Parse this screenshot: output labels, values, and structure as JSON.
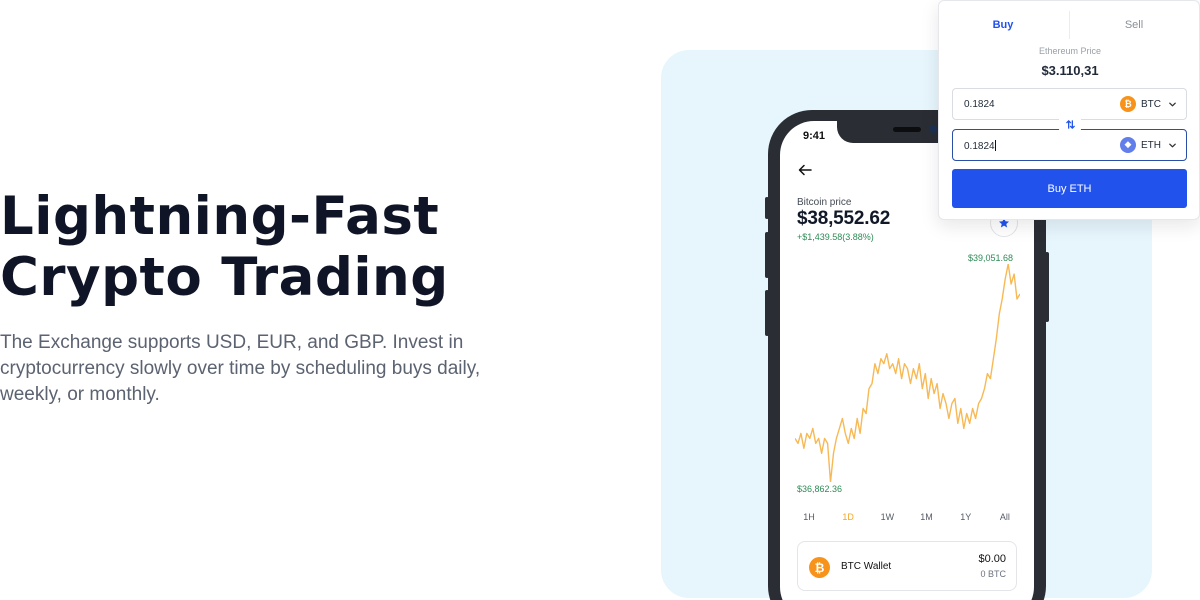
{
  "hero": {
    "title_line1": "Lightning-Fast",
    "title_line2": "Crypto Trading",
    "description": "The Exchange supports USD, EUR, and GBP. Invest in cryptocurrency slowly over time by scheduling buys daily, weekly, or monthly."
  },
  "phone": {
    "status_time": "9:41",
    "price_label": "Bitcoin price",
    "price_value": "$38,552.62",
    "price_change": "+$1,439.58(3.88%)",
    "chart_high": "$39,051.68",
    "chart_low": "$36,862.36",
    "timeframes": [
      {
        "label": "1H",
        "active": false
      },
      {
        "label": "1D",
        "active": true
      },
      {
        "label": "1W",
        "active": false
      },
      {
        "label": "1M",
        "active": false
      },
      {
        "label": "1Y",
        "active": false
      },
      {
        "label": "All",
        "active": false
      }
    ],
    "wallet": {
      "name": "BTC Wallet",
      "value": "$0.00",
      "amount": "0 BTC",
      "icon_glyph": "₿"
    },
    "chart_color": "#f7b955",
    "chart_series": [
      37300,
      37250,
      37350,
      37200,
      37350,
      37300,
      37400,
      37250,
      37300,
      37150,
      37300,
      37250,
      36862,
      37150,
      37300,
      37400,
      37500,
      37350,
      37250,
      37400,
      37300,
      37500,
      37350,
      37600,
      37550,
      37800,
      37850,
      38050,
      37950,
      38100,
      38050,
      38150,
      38000,
      38050,
      37950,
      38100,
      37900,
      38050,
      38000,
      37850,
      38000,
      37900,
      38050,
      37800,
      37950,
      37700,
      37900,
      37750,
      37850,
      37600,
      37750,
      37650,
      37500,
      37650,
      37700,
      37450,
      37600,
      37400,
      37550,
      37450,
      37600,
      37500,
      37650,
      37700,
      37800,
      37950,
      37900,
      38100,
      38300,
      38550,
      38700,
      38900,
      39051,
      38850,
      38950,
      38700,
      38750
    ]
  },
  "trade": {
    "tab_buy": "Buy",
    "tab_sell": "Sell",
    "price_label": "Ethereum Price",
    "price_value": "$3.110,31",
    "from_value": "0.1824",
    "from_coin": "BTC",
    "to_value": "0.1824",
    "to_coin": "ETH",
    "buy_label": "Buy ETH",
    "accent_color": "#2152ec",
    "btc_glyph": "₿",
    "eth_glyph": "◆"
  },
  "colors": {
    "panel_bg": "#e6f6fc",
    "positive": "#2e8b57",
    "btc": "#f7931a",
    "eth": "#627eea"
  }
}
